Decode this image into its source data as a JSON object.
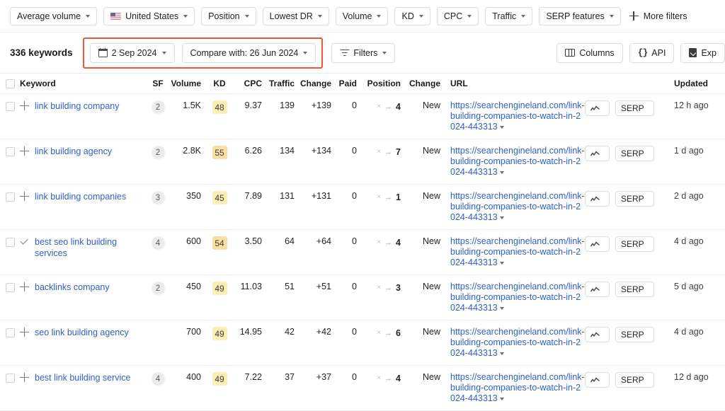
{
  "filter_bar": {
    "filters": [
      {
        "label": "Average volume",
        "icon": null
      },
      {
        "label": "United States",
        "icon": "us-flag-icon"
      },
      {
        "label": "Position",
        "icon": null
      },
      {
        "label": "Lowest DR",
        "icon": null
      },
      {
        "label": "Volume",
        "icon": null
      },
      {
        "label": "KD",
        "icon": null
      },
      {
        "label": "CPC",
        "icon": null
      },
      {
        "label": "Traffic",
        "icon": null
      },
      {
        "label": "SERP features",
        "icon": null
      }
    ],
    "more_filters_label": "More filters",
    "more_filters_icon": "plus-icon"
  },
  "toolbar": {
    "keyword_count": "336 keywords",
    "date_label": "2 Sep 2024",
    "date_icon": "calendar-icon",
    "compare_label": "Compare with: 26 Jun 2024",
    "filters_label": "Filters",
    "filters_icon": "funnel-icon",
    "columns_label": "Columns",
    "columns_icon": "columns-icon",
    "api_label": "API",
    "api_icon": "braces-icon",
    "export_label": "Exp",
    "export_icon": "download-icon",
    "highlight_color": "#f4523b"
  },
  "table": {
    "headers": {
      "keyword": "Keyword",
      "sf": "SF",
      "volume": "Volume",
      "kd": "KD",
      "cpc": "CPC",
      "traffic": "Traffic",
      "change1": "Change",
      "paid": "Paid",
      "position": "Position",
      "change2": "Change",
      "url": "URL",
      "updated": "Updated"
    },
    "row_actions": {
      "chart_icon": "sparkline-icon",
      "serp_label": "SERP"
    },
    "rows": [
      {
        "icon": "plus-icon",
        "keyword": "link building company",
        "sf": "2",
        "volume": "1.5K",
        "kd": "48",
        "kd_color": "#fceeb6",
        "cpc": "9.37",
        "traffic": "139",
        "change1": "+139",
        "paid": "0",
        "pos_prev": "×",
        "pos_arrow": "→",
        "pos_val": "4",
        "change2": "New",
        "url": "https://searchengineland.com/link-building-companies-to-watch-in-2024-443313",
        "updated": "12 h ago"
      },
      {
        "icon": "plus-icon",
        "keyword": "link building agency",
        "sf": "2",
        "volume": "2.8K",
        "kd": "55",
        "kd_color": "#fadfa1",
        "cpc": "6.26",
        "traffic": "134",
        "change1": "+134",
        "paid": "0",
        "pos_prev": "×",
        "pos_arrow": "→",
        "pos_val": "7",
        "change2": "New",
        "url": "https://searchengineland.com/link-building-companies-to-watch-in-2024-443313",
        "updated": "1 d ago"
      },
      {
        "icon": "plus-icon",
        "keyword": "link building companies",
        "sf": "3",
        "volume": "350",
        "kd": "45",
        "kd_color": "#fceeb6",
        "cpc": "7.89",
        "traffic": "131",
        "change1": "+131",
        "paid": "0",
        "pos_prev": "×",
        "pos_arrow": "→",
        "pos_val": "1",
        "change2": "New",
        "url": "https://searchengineland.com/link-building-companies-to-watch-in-2024-443313",
        "updated": "2 d ago"
      },
      {
        "icon": "check-icon",
        "keyword": "best seo link building services",
        "sf": "4",
        "volume": "600",
        "kd": "54",
        "kd_color": "#fadfa1",
        "cpc": "3.50",
        "traffic": "64",
        "change1": "+64",
        "paid": "0",
        "pos_prev": "×",
        "pos_arrow": "→",
        "pos_val": "4",
        "change2": "New",
        "url": "https://searchengineland.com/link-building-companies-to-watch-in-2024-443313",
        "updated": "4 d ago"
      },
      {
        "icon": "plus-icon",
        "keyword": "backlinks company",
        "sf": "2",
        "volume": "450",
        "kd": "49",
        "kd_color": "#fceeb6",
        "cpc": "11.03",
        "traffic": "51",
        "change1": "+51",
        "paid": "0",
        "pos_prev": "×",
        "pos_arrow": "→",
        "pos_val": "3",
        "change2": "New",
        "url": "https://searchengineland.com/link-building-companies-to-watch-in-2024-443313",
        "updated": "5 d ago"
      },
      {
        "icon": "plus-icon",
        "keyword": "seo link building agency",
        "sf": "",
        "volume": "700",
        "kd": "49",
        "kd_color": "#fceeb6",
        "cpc": "14.95",
        "traffic": "42",
        "change1": "+42",
        "paid": "0",
        "pos_prev": "×",
        "pos_arrow": "→",
        "pos_val": "6",
        "change2": "New",
        "url": "https://searchengineland.com/link-building-companies-to-watch-in-2024-443313",
        "updated": "4 d ago"
      },
      {
        "icon": "plus-icon",
        "keyword": "best link building service",
        "sf": "4",
        "volume": "400",
        "kd": "49",
        "kd_color": "#fceeb6",
        "cpc": "7.22",
        "traffic": "37",
        "change1": "+37",
        "paid": "0",
        "pos_prev": "×",
        "pos_arrow": "→",
        "pos_val": "4",
        "change2": "New",
        "url": "https://searchengineland.com/link-building-companies-to-watch-in-2024-443313",
        "updated": "12 d ago"
      }
    ]
  }
}
